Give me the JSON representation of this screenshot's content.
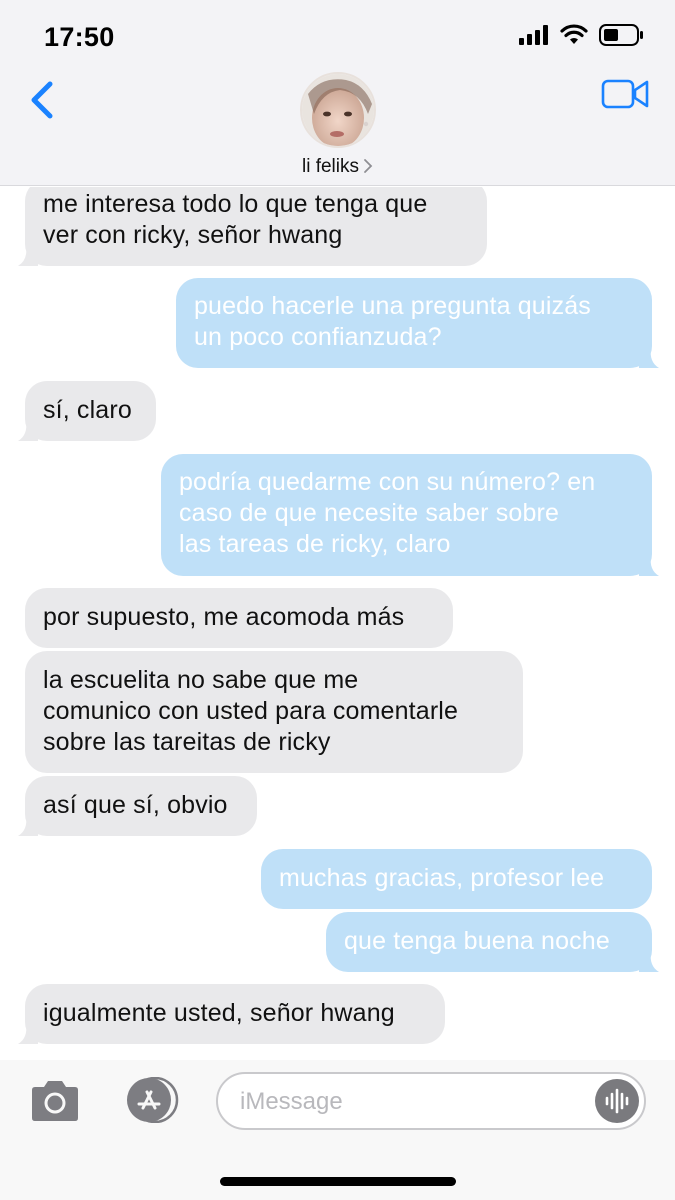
{
  "status_bar": {
    "time": "17:50"
  },
  "header": {
    "contact_name": "li feliks"
  },
  "messages": [
    {
      "direction": "in",
      "lines": [
        "me interesa todo lo que tenga que",
        "ver con ricky, señor hwang"
      ]
    },
    {
      "direction": "out",
      "lines": [
        "puedo hacerle una pregunta quizás",
        "un poco confianzuda?"
      ]
    },
    {
      "direction": "in",
      "lines": [
        "sí, claro"
      ]
    },
    {
      "direction": "out",
      "lines": [
        "podría quedarme con su número? en",
        "caso de que necesite saber sobre",
        "las tareas de ricky, claro"
      ]
    },
    {
      "direction": "in",
      "lines": [
        "por supuesto, me acomoda más"
      ]
    },
    {
      "direction": "in",
      "lines": [
        "la escuelita no sabe que me",
        "comunico con usted para comentarle",
        "sobre las tareitas de ricky"
      ]
    },
    {
      "direction": "in",
      "lines": [
        "así que sí, obvio"
      ]
    },
    {
      "direction": "out",
      "lines": [
        "muchas gracias, profesor lee"
      ]
    },
    {
      "direction": "out",
      "lines": [
        "que tenga buena noche"
      ]
    },
    {
      "direction": "in",
      "lines": [
        "igualmente usted, señor hwang"
      ]
    }
  ],
  "input": {
    "placeholder": "iMessage"
  },
  "colors": {
    "incoming_bubble": "#e9e9eb",
    "outgoing_bubble": "#bfe0f8",
    "accent": "#1a82ff"
  },
  "icons": [
    "back-chevron-icon",
    "video-camera-icon",
    "camera-icon",
    "app-store-icon",
    "audio-waveform-icon"
  ]
}
